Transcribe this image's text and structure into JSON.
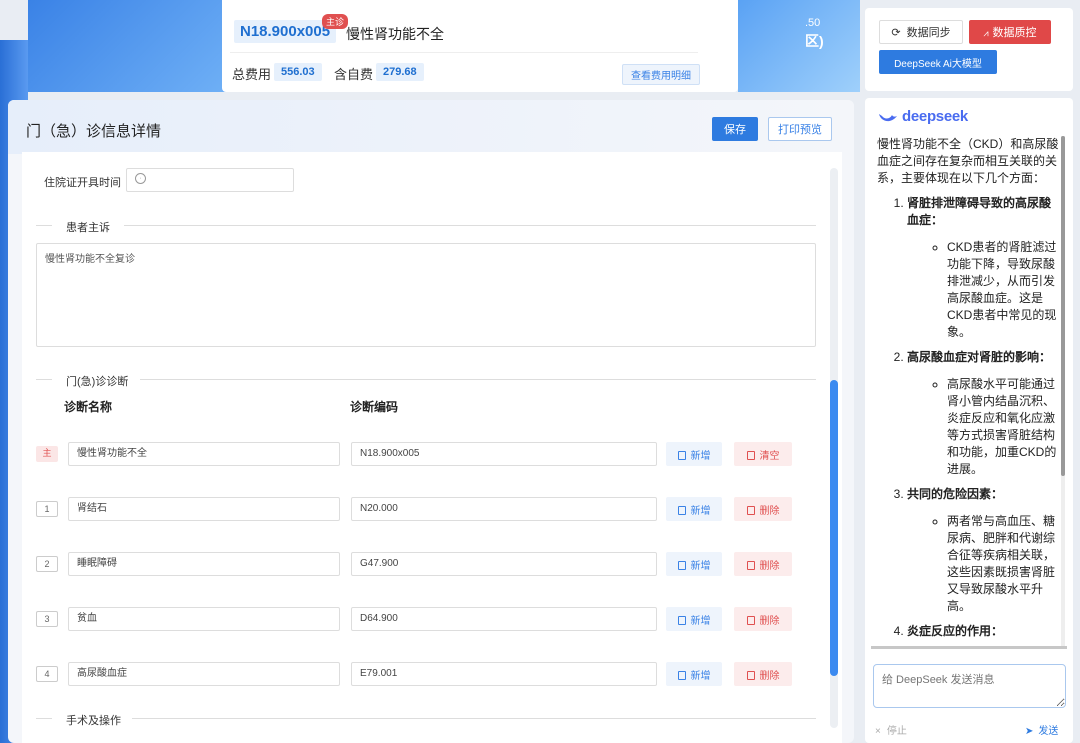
{
  "header": {
    "diag_code": "N18.900x005",
    "main_badge": "主诊",
    "diag_name": "慢性肾功能不全",
    "total_fee_label": "总费用",
    "total_fee": "556.03",
    "self_fee_label": "含自费",
    "self_fee": "279.68",
    "fee_detail_button": "查看费用明细",
    "right_text_top": ".50",
    "right_text_bottom": "区)"
  },
  "main": {
    "title": "门（急）诊信息详情",
    "save_button": "保存",
    "print_button": "打印预览",
    "cert_time_label": "住院证开具时间",
    "complaint_section": "患者主诉",
    "complaint_text": "慢性肾功能不全复诊",
    "diagnosis_section": "门(急)诊诊断",
    "col_name": "诊断名称",
    "col_code": "诊断编码",
    "surgery_section": "手术及操作",
    "diagnoses": [
      {
        "index": "主",
        "name": "慢性肾功能不全",
        "code": "N18.900x005",
        "add": "新增",
        "action": "清空"
      },
      {
        "index": "1",
        "name": "肾结石",
        "code": "N20.000",
        "add": "新增",
        "action": "删除"
      },
      {
        "index": "2",
        "name": "睡眠障碍",
        "code": "G47.900",
        "add": "新增",
        "action": "删除"
      },
      {
        "index": "3",
        "name": "贫血",
        "code": "D64.900",
        "add": "新增",
        "action": "删除"
      },
      {
        "index": "4",
        "name": "高尿酸血症",
        "code": "E79.001",
        "add": "新增",
        "action": "删除"
      }
    ]
  },
  "right_panel": {
    "sync_button": "数据同步",
    "qc_button": "数据质控",
    "ai_button": "DeepSeek Ai大模型",
    "logo_text": "deepseek",
    "intro": "慢性肾功能不全（CKD）和高尿酸血症之间存在复杂而相互关联的关系，主要体现在以下几个方面：",
    "points": [
      {
        "title": "肾脏排泄障碍导致的高尿酸血症：",
        "detail": "CKD患者的肾脏滤过功能下降，导致尿酸排泄减少，从而引发高尿酸血症。这是CKD患者中常见的现象。"
      },
      {
        "title": "高尿酸血症对肾脏的影响：",
        "detail": "高尿酸水平可能通过肾小管内结晶沉积、炎症反应和氧化应激等方式损害肾脏结构和功能，加重CKD的进展。"
      },
      {
        "title": "共同的危险因素：",
        "detail": "两者常与高血压、糖尿病、肥胖和代谢综合征等疾病相关联，这些因素既损害肾脏又导致尿酸水平升高。"
      },
      {
        "title": "炎症反应的作用：",
        "detail": ""
      }
    ],
    "input_placeholder": "给 DeepSeek 发送消息",
    "stop_label": "停止",
    "send_label": "发送"
  },
  "colors": {
    "primary": "#2e7be0",
    "danger": "#e04848",
    "logo": "#4a6cf0"
  }
}
